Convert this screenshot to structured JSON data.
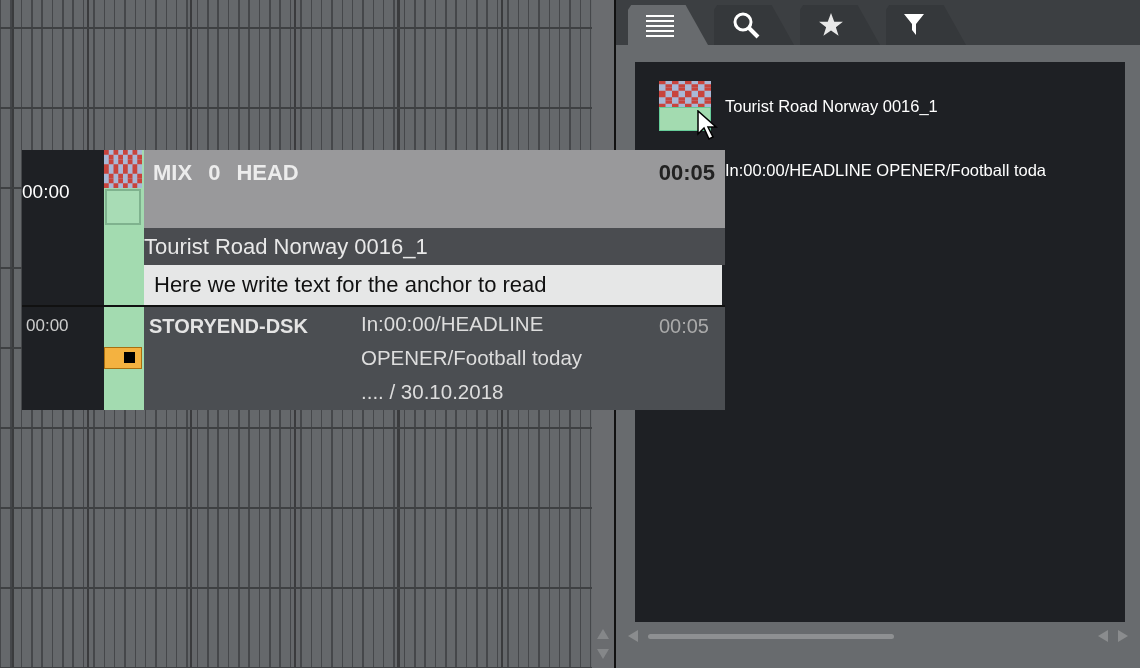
{
  "drag_item": {
    "time": "00:00",
    "title_parts": [
      "MIX",
      "0",
      "HEAD"
    ],
    "duration": "00:05",
    "clip_title": "Tourist Road Norway 0016_1",
    "script": "Here we write text for the anchor to read",
    "sub_item": {
      "time": "00:00",
      "name": "STORYEND-DSK",
      "description": "In:00:00/HEADLINE OPENER/Football today .... / 30.10.2018",
      "duration": "00:05"
    }
  },
  "panel": {
    "tabs": [
      {
        "kind": "list",
        "selected": true
      },
      {
        "kind": "search",
        "selected": false
      },
      {
        "kind": "favorites",
        "selected": false
      },
      {
        "kind": "filter",
        "selected": false
      }
    ],
    "items": [
      {
        "kind": "clip",
        "title": "Tourist Road Norway 0016_1"
      },
      {
        "kind": "graphic",
        "title": "In:00:00/HEADLINE OPENER/Football toda"
      }
    ]
  }
}
